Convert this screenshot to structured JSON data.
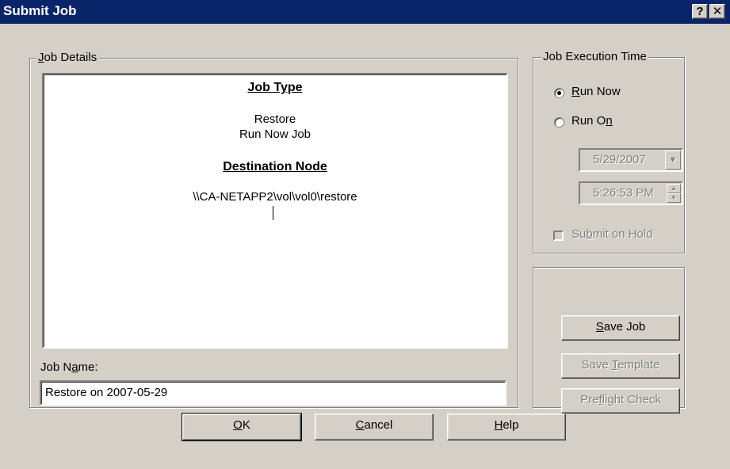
{
  "window": {
    "title": "Submit Job",
    "help_button": "?",
    "close_button": "✕"
  },
  "job_details": {
    "group_label": "Job Details",
    "job_type_heading": "Job Type",
    "job_type_line1": "Restore",
    "job_type_line2": "Run Now Job",
    "destination_heading": "Destination Node",
    "destination_path": "\\\\CA-NETAPP2\\vol\\vol0\\restore",
    "job_name_label": "Job Name:",
    "job_name_value": "Restore on 2007-05-29"
  },
  "execution_time": {
    "group_label": "Job Execution Time",
    "run_now_label": "Run Now",
    "run_on_label": "Run On",
    "selected": "Run Now",
    "date_value": "5/29/2007",
    "time_value": "5:26:53 PM",
    "submit_on_hold_label": "Submit on Hold"
  },
  "actions": {
    "save_job": "Save Job",
    "save_template": "Save Template",
    "preflight_check": "Preflight Check"
  },
  "footer": {
    "ok": "OK",
    "cancel": "Cancel",
    "help": "Help"
  },
  "colors": {
    "titlebar": "#0a246a",
    "face": "#d4d0c8"
  }
}
